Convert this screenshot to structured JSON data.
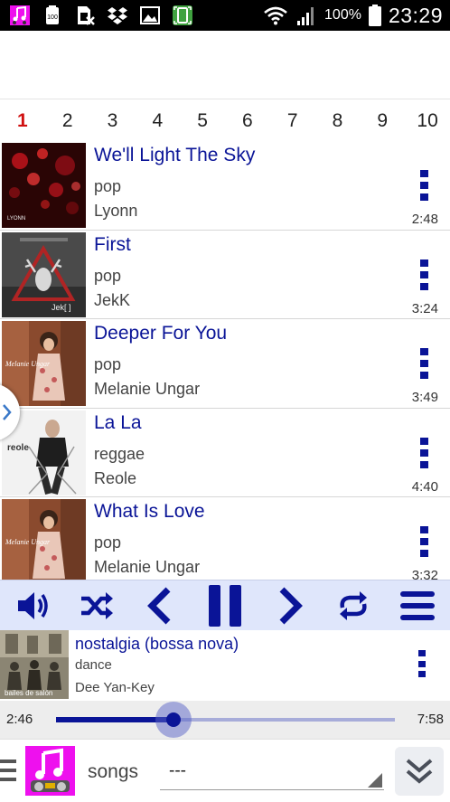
{
  "status_bar": {
    "battery_percent": "100%",
    "time": "23:29",
    "icons": [
      "music-app-icon",
      "battery-saver-icon",
      "no-sim-icon",
      "dropbox-icon",
      "gallery-icon",
      "screenshot-icon",
      "wifi-icon",
      "signal-icon",
      "battery-icon"
    ]
  },
  "pages": [
    "1",
    "2",
    "3",
    "4",
    "5",
    "6",
    "7",
    "8",
    "9",
    "10"
  ],
  "active_page": "1",
  "songs": [
    {
      "title": "We'll Light The Sky",
      "genre": "pop",
      "artist": "Lyonn",
      "duration": "2:48",
      "cover_caption": "LYONN"
    },
    {
      "title": "First",
      "genre": "pop",
      "artist": "JekK",
      "duration": "3:24",
      "cover_caption": "Jek[ ]"
    },
    {
      "title": "Deeper For You",
      "genre": "pop",
      "artist": "Melanie Ungar",
      "duration": "3:49",
      "cover_caption": "Melanie Ungar"
    },
    {
      "title": "La La",
      "genre": "reggae",
      "artist": "Reole",
      "duration": "4:40",
      "cover_caption": "reole"
    },
    {
      "title": "What Is Love",
      "genre": "pop",
      "artist": "Melanie Ungar",
      "duration": "3:32",
      "cover_caption": "Melanie Ungar"
    }
  ],
  "now_playing": {
    "title": "nostalgia (bossa nova)",
    "genre": "dance",
    "artist": "Dee Yan-Key",
    "cover_caption": "bailes de salón",
    "elapsed": "2:46",
    "total": "7:58",
    "progress": 0.347
  },
  "controls": [
    "volume-icon",
    "shuffle-icon",
    "previous-icon",
    "pause-icon",
    "next-icon",
    "repeat-icon",
    "menu-icon"
  ],
  "bottom_bar": {
    "songs_label": "songs",
    "playlist_value": "---"
  },
  "colors": {
    "accent": "#0a1497",
    "active_page": "#d01010",
    "controls_bg": "#dfe6fb",
    "logo_bg": "#ee10ee"
  }
}
